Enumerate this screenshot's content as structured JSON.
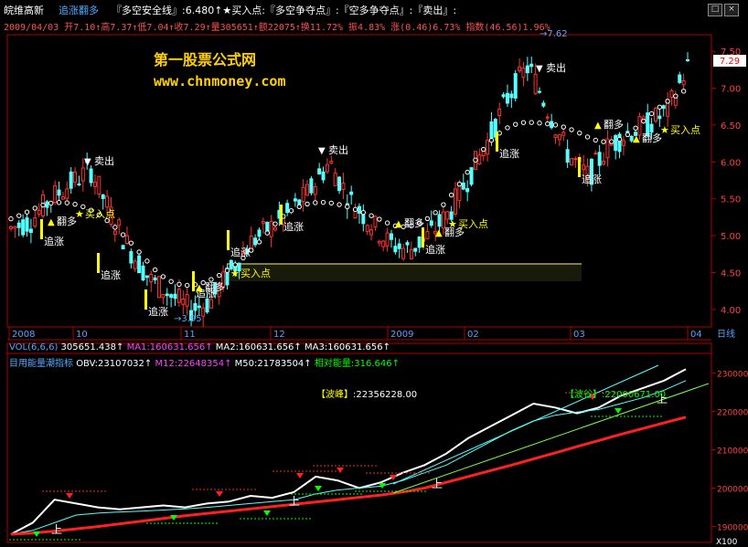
{
  "header": {
    "stock_name": "皖维高新",
    "formula_name": "追涨翻多",
    "formula_params": "『多空安全线』:6.480↑★买入点:『多空争夺点』:『空多争夺点』:『卖出』:",
    "quote_line": "2009/04/03  开7.10↑高7.37↑低7.04↑收7.29↑量305651↑额22075↑换11.72%  振4.83%  涨(0.46)6.73%  指数(46.56)1.96%",
    "window_buttons": [
      "□",
      "×"
    ]
  },
  "watermark": {
    "title": "第一股票公式网",
    "url": "www.chnmoney.com"
  },
  "price_panel": {
    "yticks": [
      "7.50",
      "7.00",
      "6.50",
      "6.00",
      "5.50",
      "5.00",
      "4.50",
      "4.00"
    ],
    "last_price": "7.29",
    "high_marker": "7.62",
    "low_marker": "3.95",
    "annotations": {
      "buy": "买入点",
      "sell": "卖出",
      "chase": "追涨",
      "turn": "翻多",
      "star": "★",
      "tri_up": "▲",
      "tri_down": "▼"
    }
  },
  "date_axis": {
    "labels": [
      "2008",
      "10",
      "11",
      "12",
      "2009",
      "02",
      "03",
      "04"
    ],
    "right_label": "日线"
  },
  "vol_line": {
    "label": "VOL(6,6,6)",
    "value": "305651.438↑",
    "ma1": "MA1:160631.656↑",
    "ma2": "MA2:160631.656↑",
    "ma3": "MA3:160631.656↑"
  },
  "obv_panel": {
    "name": "目用能量潮指标",
    "obv": "OBV:23107032↑",
    "m12": "M12:22648354↑",
    "m50": "M50:21783504↑",
    "energy": "相对能量:316.646↑",
    "peak_label": "【波峰】",
    "peak_value": ":22356228.00",
    "trough_label": "【波谷】",
    "trough_value": ":22000671.00",
    "up_mark": "上",
    "yticks": [
      "230000",
      "220000",
      "210000",
      "200000",
      "190000"
    ],
    "unit": "X100"
  },
  "colors": {
    "up": "#ff3030",
    "down": "#54ffff",
    "dots": "#ffffff",
    "gold": "#ffff00",
    "axis": "#b00000"
  },
  "chart_data": [
    {
      "type": "candlestick",
      "title": "",
      "ylim": [
        3.8,
        7.7
      ],
      "x": [
        "2008/08",
        "2008/10",
        "2008/11",
        "2008/12",
        "2009/01",
        "2009/02",
        "2009/03",
        "2009/04"
      ],
      "series": [
        {
          "values": [
            5.1,
            5.2,
            5.5,
            5.7,
            5.9,
            5.3,
            4.8,
            4.4,
            4.2,
            4.0,
            4.1,
            4.5,
            4.9,
            5.1,
            5.3,
            5.6,
            6.0,
            5.5,
            5.2,
            4.9,
            4.8,
            5.0,
            5.3,
            5.8,
            6.3,
            6.9,
            7.3,
            6.7,
            6.1,
            5.8,
            6.2,
            6.4,
            6.5,
            6.7,
            7.29
          ]
        }
      ]
    },
    {
      "type": "line",
      "title": "",
      "ylim": [
        188000,
        232000
      ],
      "series": [
        {
          "name": "OBV",
          "values": [
            188000,
            191000,
            197000,
            196000,
            195000,
            194500,
            195000,
            195500,
            195000,
            196000,
            196500,
            198000,
            197500,
            199000,
            203000,
            202000,
            200000,
            201500,
            204000,
            206000,
            209000,
            213000,
            216000,
            219000,
            222000,
            221000,
            219500,
            221000,
            224000,
            226000,
            228000,
            231000
          ]
        },
        {
          "name": "M12",
          "values": [
            188000,
            189000,
            191000,
            193000,
            193500,
            193800,
            194000,
            194300,
            194600,
            195000,
            195500,
            196000,
            196500,
            197000,
            198500,
            199500,
            200000,
            200500,
            202000,
            204000,
            206000,
            209000,
            212000,
            215000,
            217500,
            219000,
            219800,
            220500,
            222000,
            223500,
            225500,
            228000
          ]
        },
        {
          "name": "M50",
          "values": [
            188000,
            188300,
            188800,
            189400,
            190000,
            190700,
            191400,
            192100,
            192800,
            193400,
            194000,
            194600,
            195200,
            195800,
            196400,
            197000,
            197600,
            198200,
            199000,
            200000,
            201500,
            203000,
            204500,
            206000,
            207600,
            209200,
            210800,
            212400,
            214000,
            215500,
            217000,
            218500
          ]
        }
      ]
    }
  ]
}
